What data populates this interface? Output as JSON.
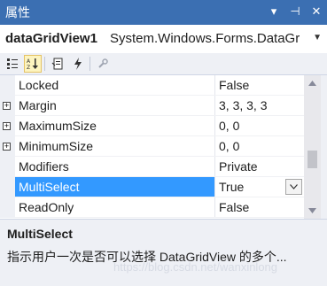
{
  "window": {
    "title": "属性",
    "controls": [
      "▾",
      "⊣",
      "✕"
    ]
  },
  "object_selector": {
    "name": "dataGridView1",
    "type": "System.Windows.Forms.DataGr",
    "dropdown": "▼"
  },
  "toolbar": {
    "buttons": [
      "categorized-icon",
      "alphabetical-icon",
      "properties-icon",
      "events-icon",
      "property-pages-icon"
    ]
  },
  "grid": {
    "rows": [
      {
        "name": "Locked",
        "value": "False",
        "expandable": false,
        "selected": false
      },
      {
        "name": "Margin",
        "value": "3, 3, 3, 3",
        "expandable": true,
        "selected": false
      },
      {
        "name": "MaximumSize",
        "value": "0, 0",
        "expandable": true,
        "selected": false
      },
      {
        "name": "MinimumSize",
        "value": "0, 0",
        "expandable": true,
        "selected": false
      },
      {
        "name": "Modifiers",
        "value": "Private",
        "expandable": false,
        "selected": false
      },
      {
        "name": "MultiSelect",
        "value": "True",
        "expandable": false,
        "selected": true
      },
      {
        "name": "ReadOnly",
        "value": "False",
        "expandable": false,
        "selected": false
      }
    ],
    "expander_glyph": "+"
  },
  "description": {
    "title": "MultiSelect",
    "text": "指示用户一次是否可以选择 DataGridView 的多个..."
  },
  "watermark": "https://blog.csdn.net/wanxinlong",
  "colors": {
    "titlebar": "#3b6fb2",
    "selection": "#3399ff"
  }
}
